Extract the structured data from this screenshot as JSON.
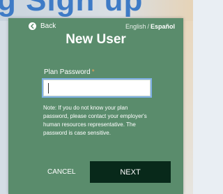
{
  "background": {
    "header_text": "g Sign up"
  },
  "card": {
    "back_label": "Back",
    "lang_english": "English",
    "lang_separator": "/",
    "lang_spanish": "Español",
    "title": "New User",
    "field_label": "Plan Password",
    "required_marker": "*",
    "password_value": "",
    "note": "Note: If you do not know your plan password, please contact your employer's human resources representative. The password is case sensitive.",
    "cancel_label": "CANCEL",
    "next_label": "NEXT"
  },
  "colors": {
    "card_bg": "#5a8c6c",
    "next_button_bg": "#08291a",
    "required_marker": "#f0a35c",
    "header_text": "#3e7bc6"
  },
  "icons": {
    "back": "arrow-left-circle-icon"
  }
}
